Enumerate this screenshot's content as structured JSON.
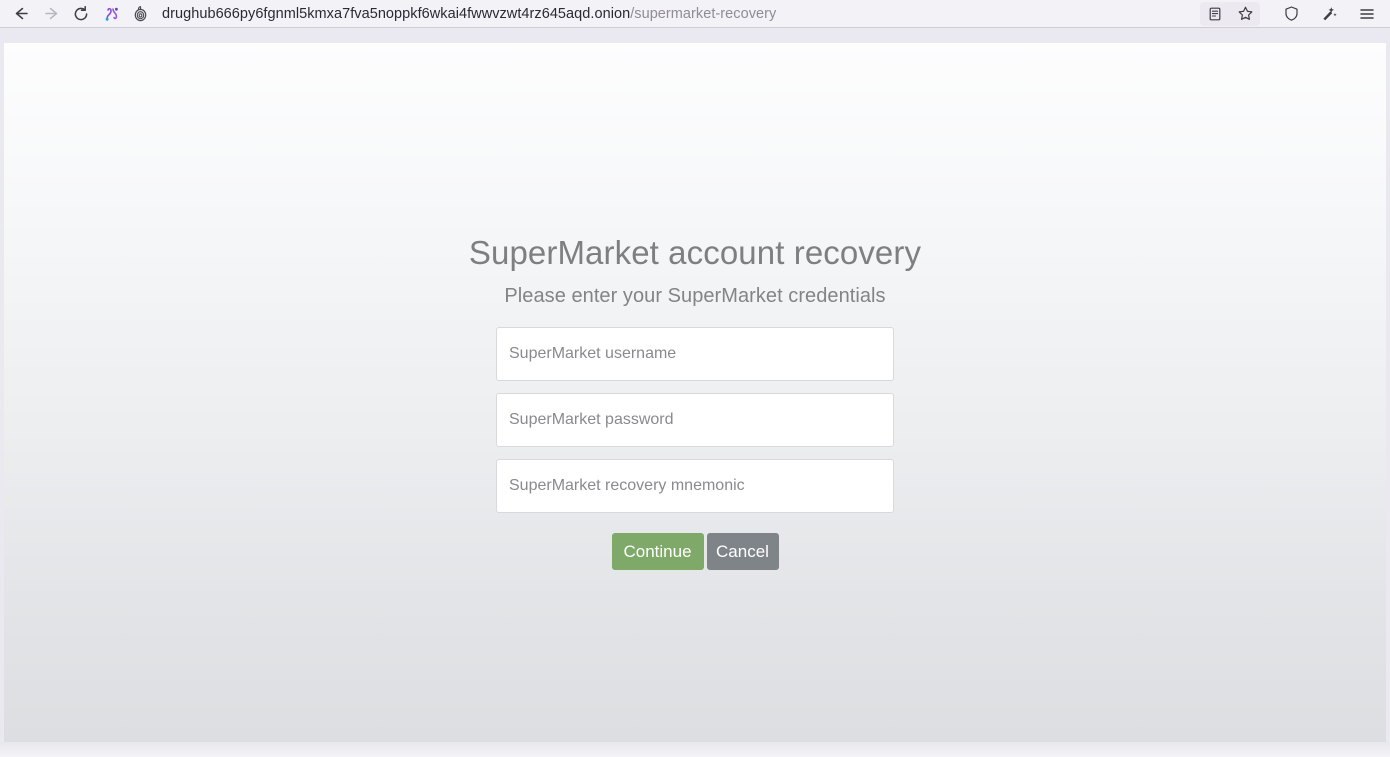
{
  "browser": {
    "nav": {
      "back_label": "Back",
      "forward_label": "Forward",
      "reload_label": "Reload"
    },
    "tor": {
      "circuit_label": "Tor circuit",
      "onion_label": "Onion site"
    },
    "url": {
      "host": "drughub666py6fgnml5kmxa7fva5noppkf6wkai4fwwvzwt4rz645aqd.onion",
      "path": "/supermarket-recovery"
    },
    "toolbar_icons": [
      {
        "name": "reader-view-icon",
        "label": "Reader view"
      },
      {
        "name": "bookmark-star-icon",
        "label": "Bookmark this page"
      },
      {
        "name": "shield-icon",
        "label": "Tracking protection"
      },
      {
        "name": "new-identity-icon",
        "label": "New identity"
      },
      {
        "name": "menu-icon",
        "label": "Open application menu"
      }
    ]
  },
  "page": {
    "title": "SuperMarket account recovery",
    "subtitle": "Please enter your SuperMarket credentials",
    "fields": [
      {
        "name": "username-input",
        "placeholder": "SuperMarket username",
        "value": "",
        "type": "text"
      },
      {
        "name": "password-input",
        "placeholder": "SuperMarket password",
        "value": "",
        "type": "text"
      },
      {
        "name": "mnemonic-input",
        "placeholder": "SuperMarket recovery mnemonic",
        "value": "",
        "type": "text"
      }
    ],
    "buttons": {
      "continue_label": "Continue",
      "cancel_label": "Cancel"
    },
    "colors": {
      "continue_bg": "#7fa968",
      "cancel_bg": "#7f8488",
      "title_text": "#7f7f83",
      "placeholder_text": "#8a8a8e"
    }
  }
}
